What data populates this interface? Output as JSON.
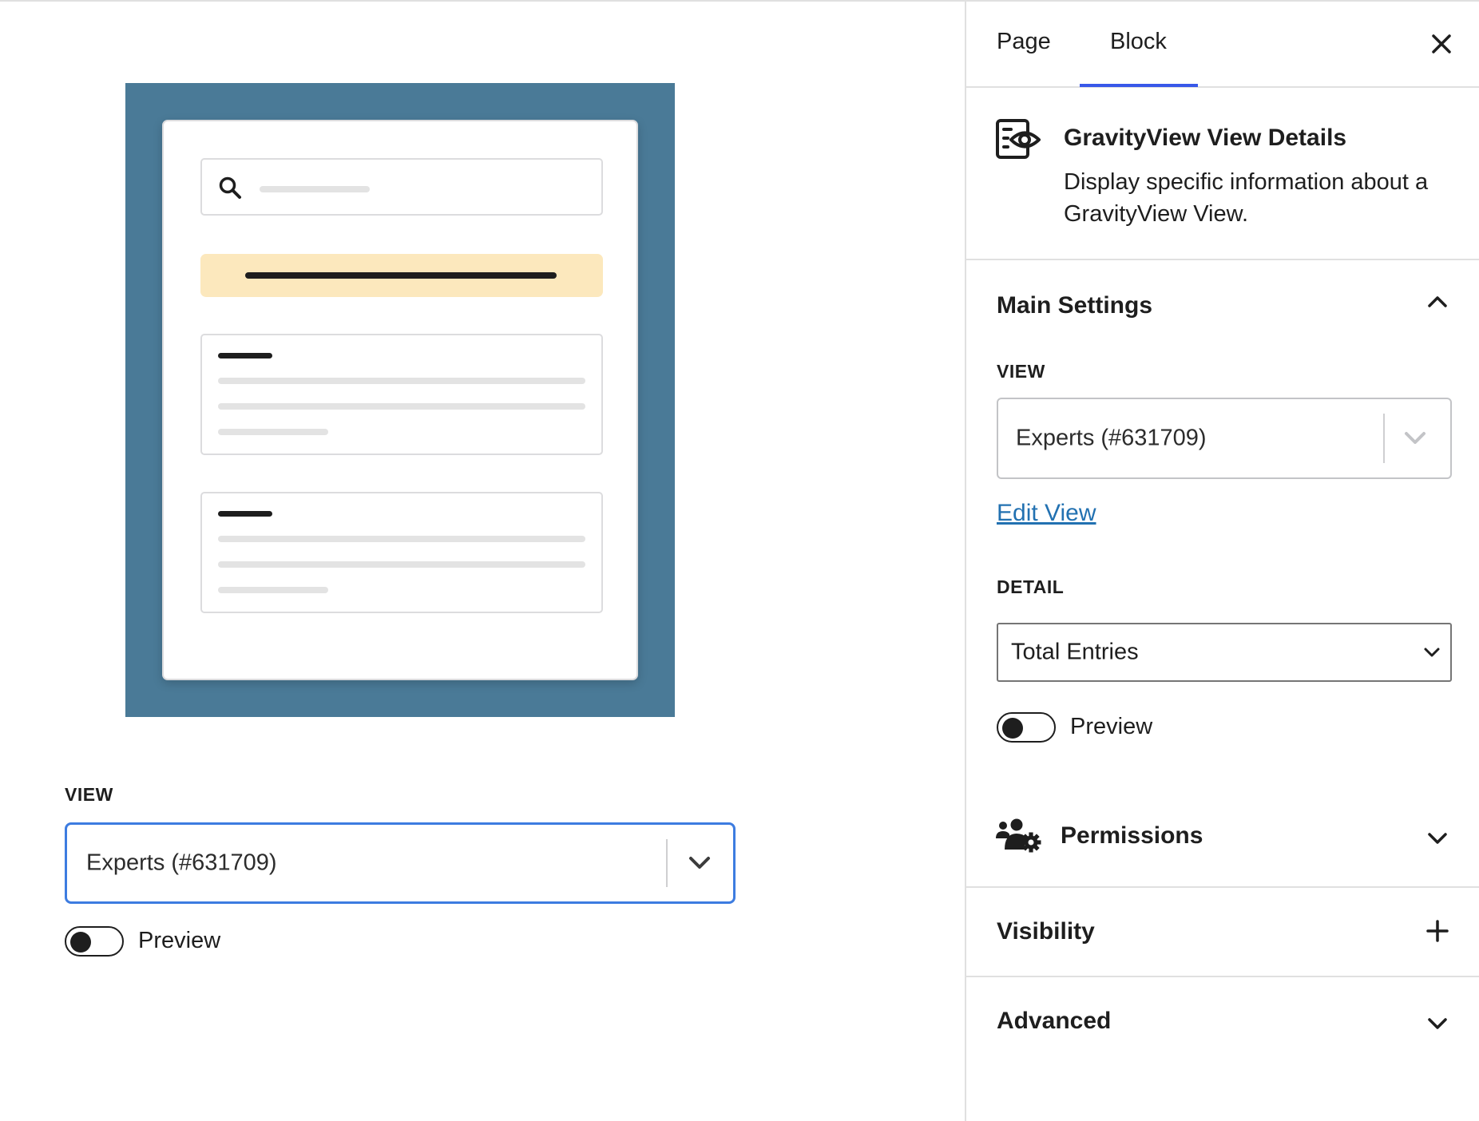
{
  "canvas": {
    "view_label": "VIEW",
    "view_select_value": "Experts (#631709)",
    "preview_label": "Preview"
  },
  "sidebar": {
    "tabs": [
      {
        "label": "Page"
      },
      {
        "label": "Block",
        "active": true
      }
    ],
    "block": {
      "title": "GravityView View Details",
      "description": "Display specific information about a GravityView View.",
      "icon": "gravityview-view-details-icon"
    },
    "main_settings": {
      "title": "Main Settings",
      "expanded": true,
      "view_label": "VIEW",
      "view_value": "Experts (#631709)",
      "edit_link": "Edit View",
      "detail_label": "DETAIL",
      "detail_value": "Total Entries",
      "preview_label": "Preview"
    },
    "permissions": {
      "title": "Permissions",
      "icon": "users-gear-icon"
    },
    "visibility": {
      "title": "Visibility"
    },
    "advanced": {
      "title": "Advanced"
    }
  },
  "colors": {
    "accent": "#3858e9",
    "focus_border": "#3d7ce0",
    "link": "#2271b1",
    "preview_background": "#4a7a97",
    "banner": "#fce8bd"
  }
}
